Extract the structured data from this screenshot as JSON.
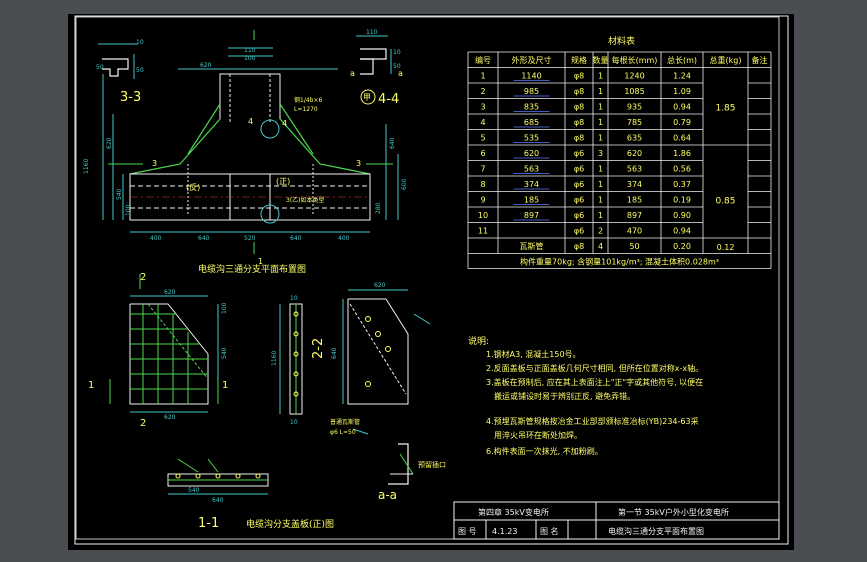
{
  "colors": {
    "background": "#4a4d52",
    "sheet": "#000000",
    "line": "#f2f2f2",
    "text": "#ffff66",
    "dim": "#44c8c8",
    "accent": "#4cd94c"
  },
  "plan": {
    "caption": "电缆沟三通分支平面布置图",
    "top_dims": [
      "110",
      "100",
      "620"
    ],
    "bottom_dims": [
      "400",
      "640",
      "520",
      "640",
      "400"
    ],
    "left_dims": [
      "1160",
      "620",
      "540",
      "100"
    ],
    "right_dims": [
      "640",
      "600",
      "280"
    ],
    "labels": [
      "(反)",
      "3",
      "3",
      "4",
      "4",
      "(正)",
      "1"
    ],
    "notes": [
      "钢1/4b×6",
      "L=1270",
      "3(乙)如本类型"
    ]
  },
  "section_33": {
    "title": "3-3",
    "dims": [
      "10",
      "50",
      "50"
    ]
  },
  "section_44": {
    "title": "4-4",
    "prefix": "甲",
    "dims": [
      "110",
      "10",
      "50"
    ],
    "marks": [
      "a",
      "a"
    ]
  },
  "material_table": {
    "title": "材料表",
    "headers": [
      "编号",
      "外形及尺寸",
      "规格",
      "数量",
      "每根长(mm)",
      "总长(m)",
      "总重(kg)",
      "备注"
    ],
    "rows": [
      [
        "1",
        "1140",
        "φ8",
        "1",
        "1240",
        "1.24"
      ],
      [
        "2",
        "985",
        "φ8",
        "1",
        "1085",
        "1.09"
      ],
      [
        "3",
        "835",
        "φ8",
        "1",
        "935",
        "0.94"
      ],
      [
        "4",
        "685",
        "φ8",
        "1",
        "785",
        "0.79"
      ],
      [
        "5",
        "535",
        "φ8",
        "1",
        "635",
        "0.64"
      ],
      [
        "6",
        "620",
        "φ6",
        "3",
        "620",
        "1.86"
      ],
      [
        "7",
        "563",
        "φ6",
        "1",
        "563",
        "0.56"
      ],
      [
        "8",
        "374",
        "φ6",
        "1",
        "374",
        "0.37"
      ],
      [
        "9",
        "185",
        "φ6",
        "1",
        "185",
        "0.19"
      ],
      [
        "10",
        "897",
        "φ6",
        "1",
        "897",
        "0.90"
      ],
      [
        "11",
        "",
        "φ6",
        "2",
        "470",
        "0.94"
      ],
      [
        "",
        "瓦斯管",
        "φ8",
        "4",
        "50",
        "0.20"
      ]
    ],
    "weights": [
      "1.85",
      "0.85",
      "0.12"
    ],
    "footer": "构件重量70kg; 含钢量101kg/m³; 混凝土体积0.028m³"
  },
  "notes": {
    "heading": "说明:",
    "items": [
      "1.钢材A3, 混凝土150号。",
      "2.反面盖板与正面盖板几何尺寸相同, 但所在位置对称x-x轴。",
      "3.盖板在预制后, 应在其上表面注上\"正\"字或其他符号, 以便在",
      "搬运或铺设时易于辨别正反, 避免弄错。",
      "4.预埋瓦斯管规格按冶金工业部部颁标准冶标(YB)234-63采",
      "用淬火吊环在断处加焊。",
      "6.构件表面一次抹光, 不加粉刷。"
    ]
  },
  "section_11": {
    "title": "1-1",
    "caption": "电缆沟分支盖板(正)图",
    "dims": [
      "640",
      "540"
    ]
  },
  "section_22": {
    "title": "2-2",
    "dims": [
      "1160",
      "10",
      "10"
    ]
  },
  "view_2": {
    "dims": [
      "620",
      "620",
      "540",
      "100"
    ],
    "labels": [
      "2",
      "2",
      "1",
      "1"
    ]
  },
  "view_aa": {
    "title": "a-a",
    "label": "预留插口",
    "bolt": "φ6 L=50",
    "pipe": "普通瓦斯管"
  },
  "view_diag": {
    "dims": [
      "620",
      "640"
    ]
  },
  "titleblock": {
    "chapter": "第四章 35kV变电所",
    "section": "第一节 35kV户外小型化变电所",
    "drawing_no_label": "图 号",
    "drawing_no": "4.1.23",
    "drawing_name_label": "图 名",
    "drawing_name": "电缆沟三通分支平面布置图"
  }
}
